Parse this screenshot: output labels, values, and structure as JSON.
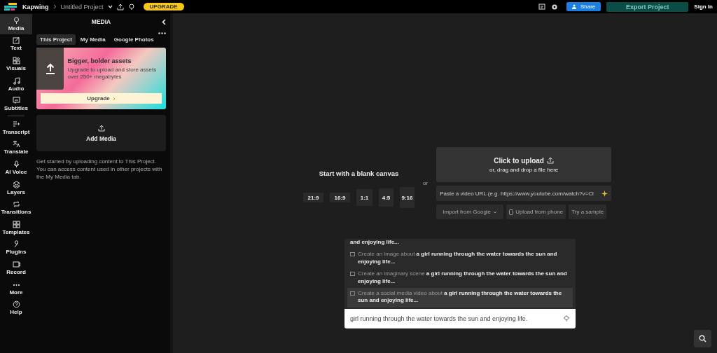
{
  "topbar": {
    "brand": "Kapwing",
    "project_title": "Untitled Project",
    "upgrade_button": "UPGRADE",
    "share_button": "Share",
    "export_button": "Export Project",
    "sign_in": "Sign In"
  },
  "rail": [
    {
      "label": "Media",
      "selected": true
    },
    {
      "label": "Text",
      "selected": false
    },
    {
      "label": "Visuals",
      "selected": false
    },
    {
      "label": "Audio",
      "selected": false
    },
    {
      "label": "Subtitles",
      "selected": false
    },
    {
      "label": "Transcript",
      "selected": false
    },
    {
      "label": "Translate",
      "selected": false
    },
    {
      "label": "AI Voice",
      "selected": false
    },
    {
      "label": "Layers",
      "selected": false
    },
    {
      "label": "Transitions",
      "selected": false
    },
    {
      "label": "Templates",
      "selected": false
    },
    {
      "label": "Plugins",
      "selected": false
    },
    {
      "label": "Record",
      "selected": false
    },
    {
      "label": "More",
      "selected": false
    },
    {
      "label": "Help",
      "selected": false
    }
  ],
  "panel": {
    "title": "MEDIA",
    "tabs": [
      {
        "label": "This Project",
        "selected": true
      },
      {
        "label": "My Media",
        "selected": false
      },
      {
        "label": "Google Photos",
        "selected": false
      }
    ],
    "promo": {
      "title": "Bigger, bolder assets",
      "text": "Upgrade to upload and store assets over 250+ megabytes",
      "button": "Upgrade"
    },
    "add_media": "Add Media",
    "hint": "Get started by uploading content to This Project. You can access content used in other projects with the My Media tab."
  },
  "canvas": {
    "title": "Start with a blank canvas",
    "ratios": [
      {
        "label": "21:9",
        "kind": "wide"
      },
      {
        "label": "16:9",
        "kind": "wide"
      },
      {
        "label": "1:1",
        "kind": "square"
      },
      {
        "label": "4:5",
        "kind": "portrait"
      },
      {
        "label": "9:16",
        "kind": "tall"
      }
    ],
    "or": "or"
  },
  "upload": {
    "title": "Click to upload",
    "subtitle": "or, drag and drop a file here",
    "url_placeholder": "Paste a video URL (e.g. https://www.youtube.com/watch?v=Cl",
    "import_button": "Import from Google",
    "phone_button": "Upload from phone",
    "sample_button": "Try a sample"
  },
  "suggestions": [
    {
      "text": "**and enjoying life...**",
      "selected": false
    },
    {
      "text": "Create an image about **a girl running through the water towards the sun and enjoying life...**",
      "selected": false
    },
    {
      "text": "Create an imaginary scene **a girl running through the water towards the sun and enjoying life...**",
      "selected": false
    },
    {
      "text": "Create a social media video about **a girl running through the water towards the sun and enjoying life...**",
      "selected": true
    }
  ],
  "prompt": {
    "value": "girl running through the water towards the sun and enjoying life."
  }
}
